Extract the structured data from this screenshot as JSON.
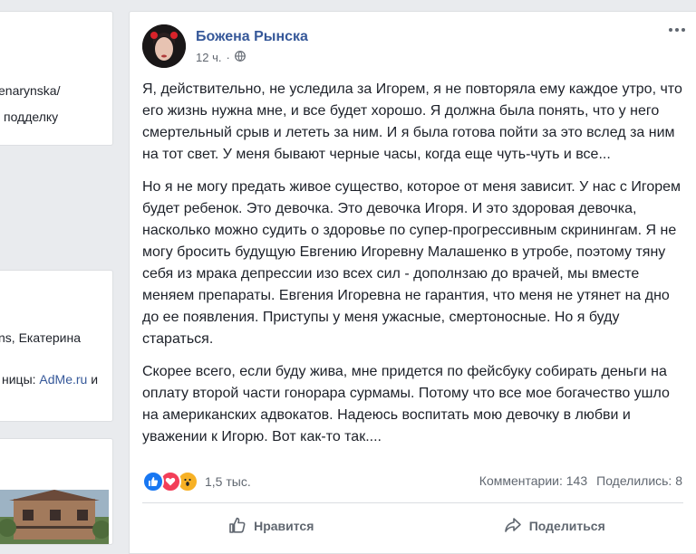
{
  "left_column": {
    "card1": {
      "lines": [
        "enarynska/",
        "подделку"
      ]
    },
    "card2": {
      "names": "ns, Екатерина",
      "pages_prefix": "ницы:",
      "pages_link": "AdMe.ru",
      "pages_suffix": "и"
    }
  },
  "post": {
    "author": "Божена Рынска",
    "time": "12 ч.",
    "privacy_icon": "globe-icon",
    "paragraphs": [
      "Я, действительно, не уследила за Игорем, я не повторяла ему каждое утро, что его жизнь нужна мне, и все будет хорошо. Я должна была понять, что у него смертельный срыв и лететь за ним. И я была готова пойти за это вслед за ним на тот свет. У меня бывают черные часы, когда еще чуть-чуть и все...",
      "Но я не могу предать живое существо, которое от меня зависит. У нас с Игорем будет ребенок. Это девочка. Это девочка Игоря. И это здоровая девочка, насколько можно судить о здоровье по супер-прогрессивным скринингам. Я не могу бросить будущую Евгению Игоревну Малашенко в утробе, поэтому тяну себя из мрака депрессии изо всех сил - дополнзаю до врачей, мы вместе меняем препараты. Евгения Игоревна не гарантия, что меня не утянет на дно до ее появления. Приступы у меня ужасные, смертоносные. Но я буду стараться.",
      "Скорее всего, если буду жива, мне придется по фейсбуку собирать деньги на оплату второй части гонорара сурмамы. Потому что все мое богачество ушло на американских адвокатов. Надеюсь воспитать мою девочку в любви и уважении к Игорю. Вот как-то так...."
    ],
    "reactions": {
      "icons": [
        "like-icon",
        "love-icon",
        "wow-icon"
      ],
      "count": "1,5 тыс."
    },
    "comments": "Комментарии: 143",
    "shares": "Поделились: 8",
    "actions": {
      "like": "Нравится",
      "share": "Поделиться"
    }
  },
  "colors": {
    "link": "#365899",
    "like_blue": "#1877f2",
    "love_red": "#f33e58",
    "wow_yellow": "#f7b125"
  }
}
